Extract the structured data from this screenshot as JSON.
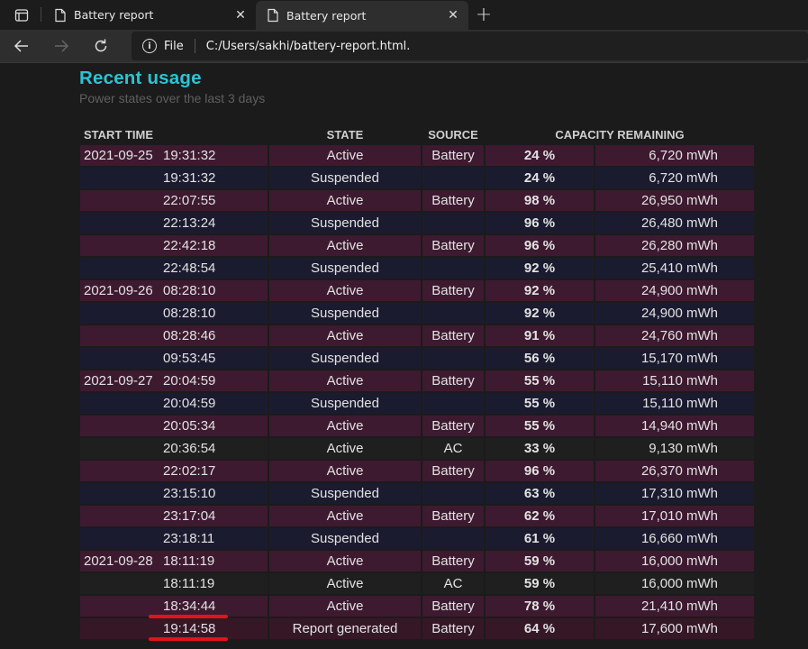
{
  "browser": {
    "tabs": [
      {
        "title": "Battery report",
        "active": false
      },
      {
        "title": "Battery report",
        "active": true
      }
    ],
    "new_tab_label": "+",
    "address": {
      "scheme_label": "File",
      "url": "C:/Users/sakhi/battery-report.html."
    }
  },
  "section": {
    "title": "Recent usage",
    "subtitle": "Power states over the last 3 days"
  },
  "table": {
    "headers": {
      "start_time": "START TIME",
      "state": "STATE",
      "source": "SOURCE",
      "capacity": "CAPACITY REMAINING"
    },
    "rows": [
      {
        "date": "2021-09-25",
        "time": "19:31:32",
        "state": "Active",
        "source": "Battery",
        "percent": "24 %",
        "mwh": "6,720 mWh",
        "kind": "battery"
      },
      {
        "date": "",
        "time": "19:31:32",
        "state": "Suspended",
        "source": "",
        "percent": "24 %",
        "mwh": "6,720 mWh",
        "kind": "suspended"
      },
      {
        "date": "",
        "time": "22:07:55",
        "state": "Active",
        "source": "Battery",
        "percent": "98 %",
        "mwh": "26,950 mWh",
        "kind": "battery"
      },
      {
        "date": "",
        "time": "22:13:24",
        "state": "Suspended",
        "source": "",
        "percent": "96 %",
        "mwh": "26,480 mWh",
        "kind": "suspended"
      },
      {
        "date": "",
        "time": "22:42:18",
        "state": "Active",
        "source": "Battery",
        "percent": "96 %",
        "mwh": "26,280 mWh",
        "kind": "battery"
      },
      {
        "date": "",
        "time": "22:48:54",
        "state": "Suspended",
        "source": "",
        "percent": "92 %",
        "mwh": "25,410 mWh",
        "kind": "suspended"
      },
      {
        "date": "2021-09-26",
        "time": "08:28:10",
        "state": "Active",
        "source": "Battery",
        "percent": "92 %",
        "mwh": "24,900 mWh",
        "kind": "battery"
      },
      {
        "date": "",
        "time": "08:28:10",
        "state": "Suspended",
        "source": "",
        "percent": "92 %",
        "mwh": "24,900 mWh",
        "kind": "suspended"
      },
      {
        "date": "",
        "time": "08:28:46",
        "state": "Active",
        "source": "Battery",
        "percent": "91 %",
        "mwh": "24,760 mWh",
        "kind": "battery"
      },
      {
        "date": "",
        "time": "09:53:45",
        "state": "Suspended",
        "source": "",
        "percent": "56 %",
        "mwh": "15,170 mWh",
        "kind": "suspended"
      },
      {
        "date": "2021-09-27",
        "time": "20:04:59",
        "state": "Active",
        "source": "Battery",
        "percent": "55 %",
        "mwh": "15,110 mWh",
        "kind": "battery"
      },
      {
        "date": "",
        "time": "20:04:59",
        "state": "Suspended",
        "source": "",
        "percent": "55 %",
        "mwh": "15,110 mWh",
        "kind": "suspended"
      },
      {
        "date": "",
        "time": "20:05:34",
        "state": "Active",
        "source": "Battery",
        "percent": "55 %",
        "mwh": "14,940 mWh",
        "kind": "battery"
      },
      {
        "date": "",
        "time": "20:36:54",
        "state": "Active",
        "source": "AC",
        "percent": "33 %",
        "mwh": "9,130 mWh",
        "kind": "ac"
      },
      {
        "date": "",
        "time": "22:02:17",
        "state": "Active",
        "source": "Battery",
        "percent": "96 %",
        "mwh": "26,370 mWh",
        "kind": "battery"
      },
      {
        "date": "",
        "time": "23:15:10",
        "state": "Suspended",
        "source": "",
        "percent": "63 %",
        "mwh": "17,310 mWh",
        "kind": "suspended"
      },
      {
        "date": "",
        "time": "23:17:04",
        "state": "Active",
        "source": "Battery",
        "percent": "62 %",
        "mwh": "17,010 mWh",
        "kind": "battery"
      },
      {
        "date": "",
        "time": "23:18:11",
        "state": "Suspended",
        "source": "",
        "percent": "61 %",
        "mwh": "16,660 mWh",
        "kind": "suspended"
      },
      {
        "date": "2021-09-28",
        "time": "18:11:19",
        "state": "Active",
        "source": "Battery",
        "percent": "59 %",
        "mwh": "16,000 mWh",
        "kind": "battery"
      },
      {
        "date": "",
        "time": "18:11:19",
        "state": "Active",
        "source": "AC",
        "percent": "59 %",
        "mwh": "16,000 mWh",
        "kind": "ac"
      },
      {
        "date": "",
        "time": "18:34:44",
        "state": "Active",
        "source": "Battery",
        "percent": "78 %",
        "mwh": "21,410 mWh",
        "kind": "battery",
        "highlighted": true
      },
      {
        "date": "",
        "time": "19:14:58",
        "state": "Report generated",
        "source": "Battery",
        "percent": "64 %",
        "mwh": "17,600 mWh",
        "kind": "report",
        "highlighted": true
      }
    ]
  },
  "colors": {
    "title_accent": "#2bc4d4",
    "row_battery": "#3d1a30",
    "row_suspended": "#1b1b30",
    "row_ac": "#1f1f1f",
    "annotation_underline": "#e0141a"
  }
}
